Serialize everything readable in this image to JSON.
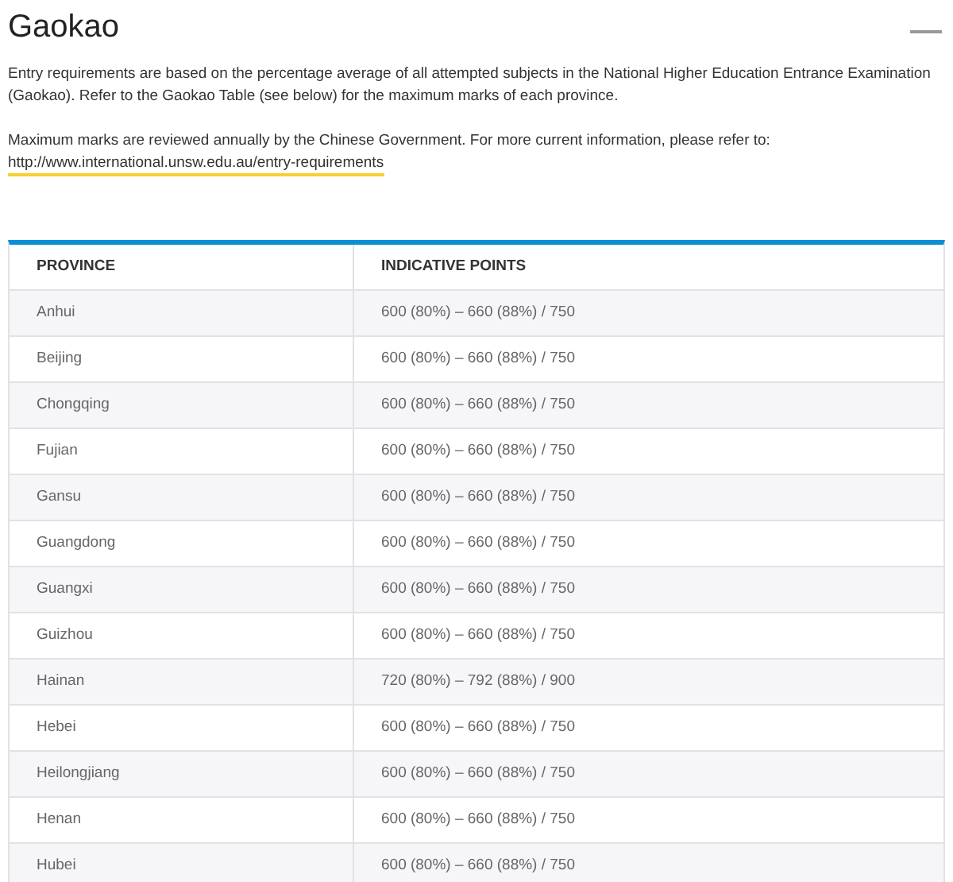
{
  "title": "Gaokao",
  "paragraphs": [
    "Entry requirements are based on the percentage average of all attempted subjects in the National Higher Education Entrance Examination (Gaokao). Refer to the Gaokao Table (see below) for the maximum marks of each province.",
    "Maximum marks are reviewed annually by the Chinese Government. For more current information, please refer to:"
  ],
  "link": "http://www.international.unsw.edu.au/entry-requirements",
  "table": {
    "columns": [
      "PROVINCE",
      "INDICATIVE POINTS"
    ],
    "rows": [
      [
        "Anhui",
        "600 (80%) – 660 (88%) / 750"
      ],
      [
        "Beijing",
        "600 (80%) – 660 (88%) / 750"
      ],
      [
        "Chongqing",
        "600 (80%) – 660 (88%) / 750"
      ],
      [
        "Fujian",
        "600 (80%) – 660 (88%) / 750"
      ],
      [
        "Gansu",
        "600 (80%) – 660 (88%) / 750"
      ],
      [
        "Guangdong",
        "600 (80%) – 660 (88%) / 750"
      ],
      [
        "Guangxi",
        "600 (80%) – 660 (88%) / 750"
      ],
      [
        "Guizhou",
        "600 (80%) – 660 (88%) / 750"
      ],
      [
        "Hainan",
        "720 (80%) – 792 (88%) / 900"
      ],
      [
        "Hebei",
        "600 (80%) – 660 (88%) / 750"
      ],
      [
        "Heilongjiang",
        "600 (80%) – 660 (88%) / 750"
      ],
      [
        "Henan",
        "600 (80%) – 660 (88%) / 750"
      ],
      [
        "Hubei",
        "600 (80%) – 660 (88%) / 750"
      ]
    ]
  }
}
